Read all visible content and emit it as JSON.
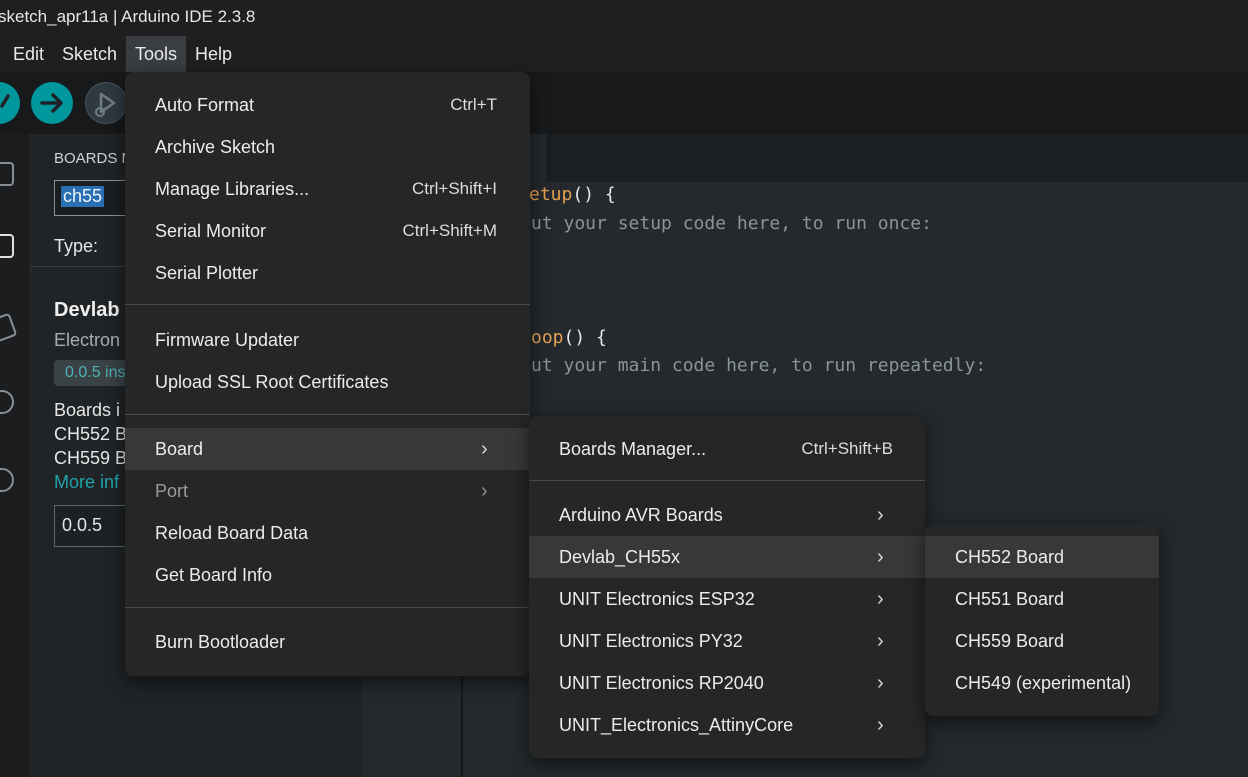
{
  "window": {
    "title": "sketch_apr11a | Arduino IDE 2.3.8"
  },
  "menubar": {
    "items": [
      "Edit",
      "Sketch",
      "Tools",
      "Help"
    ],
    "active": "Tools"
  },
  "sidebar": {
    "title": "BOARDS M",
    "search_value": "ch55",
    "type_label": "Type:",
    "package": {
      "name": "Devlab",
      "author": "Electron",
      "version_badge": "0.0.5 ins",
      "boards_label": "Boards i",
      "boards": [
        "CH552 B",
        "CH559 B"
      ],
      "more_info": "More inf",
      "version_select": "0.0.5"
    }
  },
  "editor": {
    "line1_keyword": "etup",
    "line1_rest": "() {",
    "line2": "ut your setup code here, to run once:",
    "line3_keyword": "oop",
    "line3_rest": "() {",
    "line4": "ut your main code here, to run repeatedly:"
  },
  "tools_menu": {
    "auto_format": "Auto Format",
    "auto_format_shortcut": "Ctrl+T",
    "archive_sketch": "Archive Sketch",
    "manage_libraries": "Manage Libraries...",
    "manage_libraries_shortcut": "Ctrl+Shift+I",
    "serial_monitor": "Serial Monitor",
    "serial_monitor_shortcut": "Ctrl+Shift+M",
    "serial_plotter": "Serial Plotter",
    "firmware_updater": "Firmware Updater",
    "upload_ssl": "Upload SSL Root Certificates",
    "board": "Board",
    "port": "Port",
    "reload_board_data": "Reload Board Data",
    "get_board_info": "Get Board Info",
    "burn_bootloader": "Burn Bootloader"
  },
  "board_menu": {
    "boards_manager": "Boards Manager...",
    "boards_manager_shortcut": "Ctrl+Shift+B",
    "items": [
      "Arduino AVR Boards",
      "Devlab_CH55x",
      "UNIT Electronics ESP32",
      "UNIT Electronics PY32",
      "UNIT Electronics RP2040",
      "UNIT_Electronics_AttinyCore"
    ],
    "highlighted": "Devlab_CH55x"
  },
  "devlab_menu": {
    "items": [
      "CH552 Board",
      "CH551 Board",
      "CH559 Board",
      "CH549 (experimental)"
    ],
    "highlighted": "CH552 Board"
  },
  "colors": {
    "accent_teal": "#00979d",
    "code_keyword": "#e5a050",
    "code_comment": "#8a9499"
  }
}
